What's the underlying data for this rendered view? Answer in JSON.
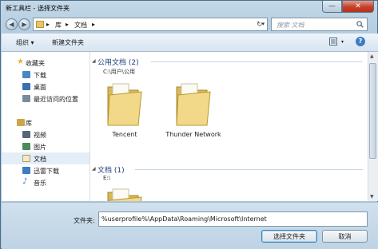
{
  "window": {
    "title": "新工具栏 - 选择文件夹",
    "close_glyph": "✕",
    "min_glyph": "—"
  },
  "address": {
    "parts": [
      "库",
      "文档"
    ],
    "separator": "▸",
    "search_placeholder": "搜索 文档"
  },
  "toolbar": {
    "organize": "组织 ▾",
    "new_folder": "新建文件夹",
    "help": "?"
  },
  "sidebar": {
    "items": [
      {
        "label": "收藏夹",
        "icon": "star-icon",
        "color": "#e8b62c"
      },
      {
        "label": "下载",
        "icon": "download-folder-icon",
        "color": "#4b86c6"
      },
      {
        "label": "桌面",
        "icon": "desktop-icon",
        "color": "#3b6fb0"
      },
      {
        "label": "最近访问的位置",
        "icon": "recent-places-icon",
        "color": "#7a8c9c"
      },
      {
        "label": "库",
        "icon": "libraries-icon",
        "color": "#c9a646"
      },
      {
        "label": "视频",
        "icon": "video-library-icon",
        "color": "#55667a"
      },
      {
        "label": "图片",
        "icon": "picture-library-icon",
        "color": "#4f8a5a"
      },
      {
        "label": "文档",
        "icon": "document-library-icon",
        "color": "#e1d8a8"
      },
      {
        "label": "迅雷下载",
        "icon": "thunder-download-icon",
        "color": "#3f7cc4"
      },
      {
        "label": "音乐",
        "icon": "music-library-icon",
        "color": "#3c76c0"
      }
    ]
  },
  "content": {
    "groups": [
      {
        "header": "公用文档 (2)",
        "path": "C:\\用户\\公用"
      },
      {
        "header": "文档 (1)",
        "path": "E:\\"
      }
    ],
    "folders": [
      "Tencent",
      "Thunder Network"
    ]
  },
  "bottom": {
    "folder_label": "文件夹:",
    "folder_value": "%userprofile%\\AppData\\Roaming\\Microsoft\\Internet",
    "select_button": "选择文件夹",
    "cancel_button": "取消"
  }
}
